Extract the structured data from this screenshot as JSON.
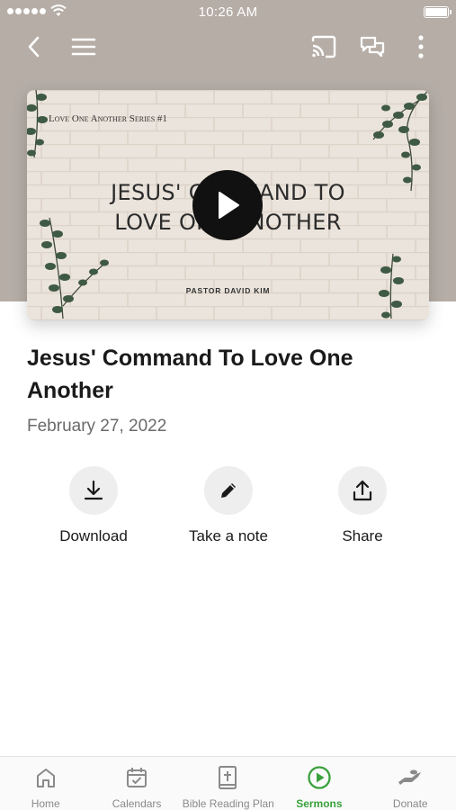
{
  "status_bar": {
    "time": "10:26 AM"
  },
  "video": {
    "series_label": "Love One Another Series #1",
    "title_line1": "JESUS' COMMAND TO",
    "title_line2": "LOVE ONE ANOTHER",
    "pastor": "PASTOR DAVID KIM"
  },
  "sermon": {
    "title": "Jesus' Command To Love One Another",
    "date": "February 27, 2022"
  },
  "actions": {
    "download": "Download",
    "note": "Take a note",
    "share": "Share"
  },
  "tabs": [
    {
      "label": "Home",
      "icon": "home-icon"
    },
    {
      "label": "Calendars",
      "icon": "calendar-icon"
    },
    {
      "label": "Bible Reading Plan",
      "icon": "bible-icon"
    },
    {
      "label": "Sermons",
      "icon": "play-circle-icon",
      "active": true
    },
    {
      "label": "Donate",
      "icon": "donate-hand-icon"
    }
  ],
  "colors": {
    "accent": "#3aa13c",
    "hero_bg": "#b5ada6"
  }
}
